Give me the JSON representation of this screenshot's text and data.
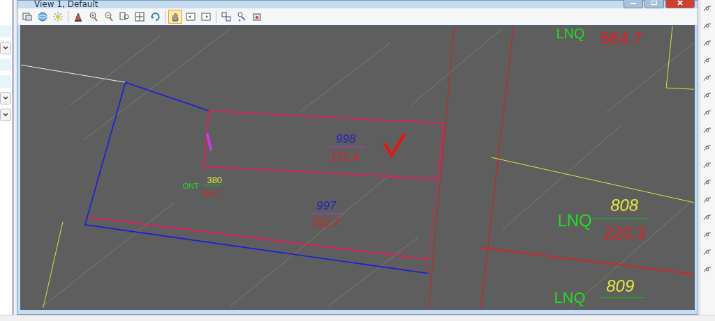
{
  "window": {
    "title": "View 1, Default"
  },
  "toolbar": {
    "tools": [
      {
        "selected": false
      },
      {
        "selected": false
      },
      {
        "selected": false
      },
      {
        "selected": false
      },
      {
        "selected": false
      },
      {
        "selected": false
      },
      {
        "selected": false
      },
      {
        "selected": false
      },
      {
        "selected": false
      },
      {
        "selected": true
      },
      {
        "selected": false
      },
      {
        "selected": false
      },
      {
        "selected": false
      },
      {
        "selected": false
      },
      {
        "selected": false
      }
    ]
  },
  "drawing": {
    "labels": [
      {
        "text": "LNQ",
        "color": "#22dd22"
      },
      {
        "text": "664.7",
        "color": "#e02020"
      },
      {
        "text": "998",
        "color": "#2222bb"
      },
      {
        "text": "151.4",
        "color": "#dd2020"
      },
      {
        "text": "997",
        "color": "#2222bb"
      },
      {
        "text": "352.7",
        "color": "#dd2020"
      },
      {
        "text": "ONT",
        "color": "#22dd22"
      },
      {
        "text": "380",
        "color": "#e8e840"
      },
      {
        "text": "380.7",
        "color": "#dd2020"
      },
      {
        "text": "808",
        "color": "#e8e840"
      },
      {
        "text": "LNQ",
        "color": "#22dd22"
      },
      {
        "text": "220.3",
        "color": "#e02020"
      },
      {
        "text": "809",
        "color": "#e8e840"
      },
      {
        "text": "LNQ",
        "color": "#22dd22"
      }
    ]
  }
}
